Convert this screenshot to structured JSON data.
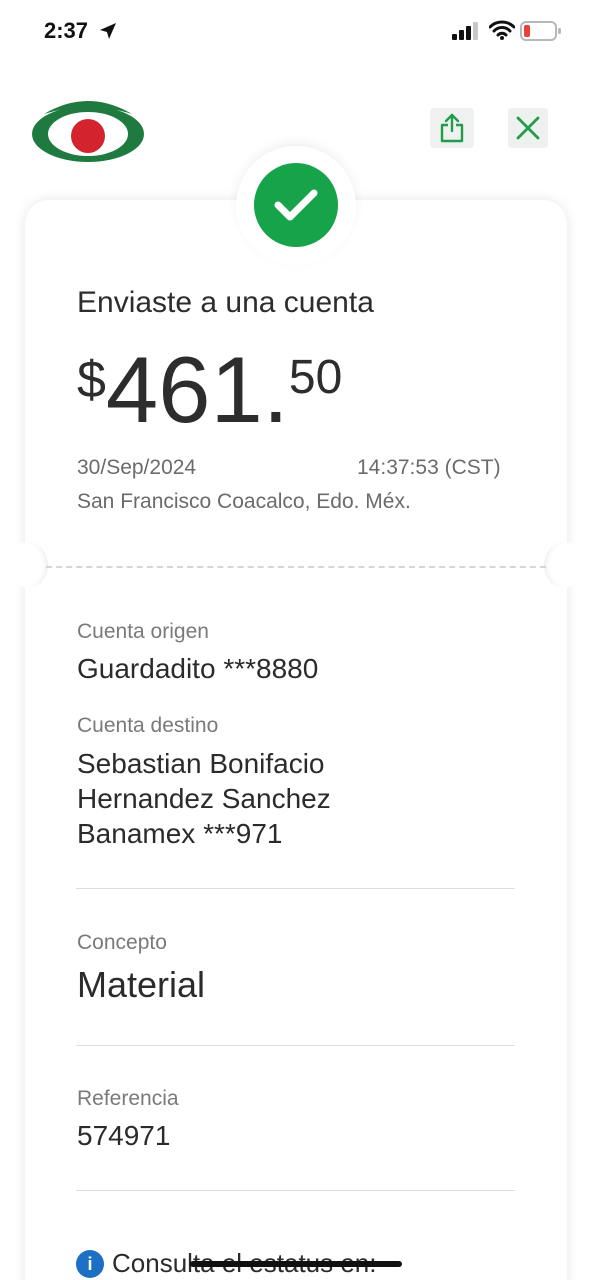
{
  "status_bar": {
    "time": "2:37",
    "colors": {
      "battery_low": "#e8403a"
    }
  },
  "header": {
    "logo_icon": "bank-logo-icon",
    "share_icon": "share-icon",
    "close_icon": "close-icon",
    "accent": "#1f9d4a"
  },
  "receipt": {
    "status_icon": "check-circle-icon",
    "heading": "Enviaste a una cuenta",
    "amount": {
      "currency": "$",
      "integer": "461",
      "dot": ".",
      "decimals": "50"
    },
    "date": "30/Sep/2024",
    "time": "14:37:53 (CST)",
    "location": "San Francisco Coacalco, Edo. Méx."
  },
  "details": {
    "origin": {
      "label": "Cuenta origen",
      "value": "Guardadito ***8880"
    },
    "destination": {
      "label": "Cuenta destino",
      "line1": "Sebastian Bonifacio",
      "line2": "Hernandez Sanchez",
      "line3": "Banamex ***971"
    },
    "concept": {
      "label": "Concepto",
      "value": "Material"
    },
    "reference": {
      "label": "Referencia",
      "value": "574971"
    }
  },
  "footer": {
    "info_icon": "info-icon",
    "info_glyph": "i",
    "info_text": "Consulta el estatus en:"
  }
}
